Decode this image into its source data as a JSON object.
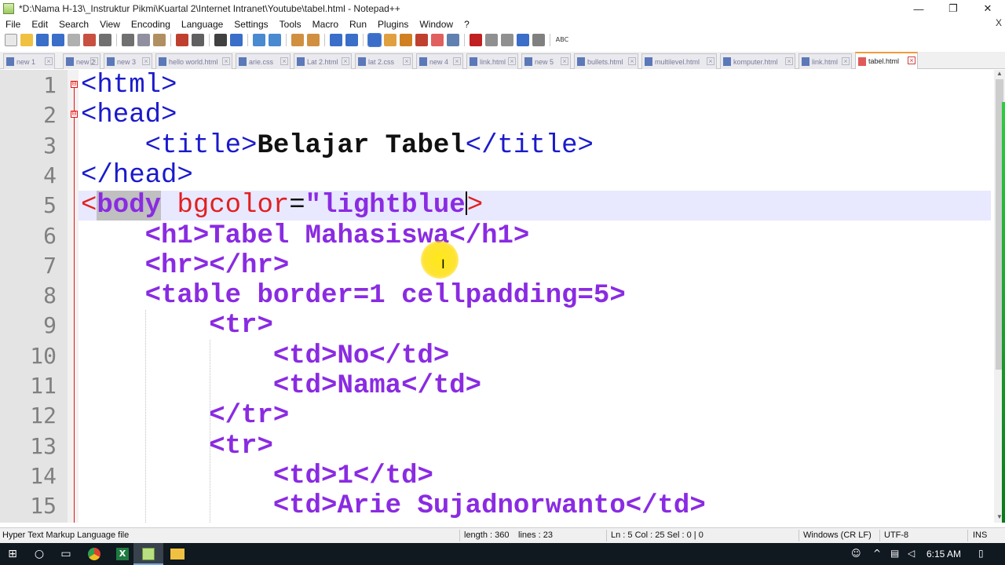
{
  "window": {
    "title": "*D:\\Nama H-13\\_Instruktur Pikmi\\Kuartal 2\\Internet Intranet\\Youtube\\tabel.html - Notepad++",
    "minimize": "—",
    "restore": "❐",
    "close": "✕",
    "menu_close": "X"
  },
  "menu": [
    "File",
    "Edit",
    "Search",
    "View",
    "Encoding",
    "Language",
    "Settings",
    "Tools",
    "Macro",
    "Run",
    "Plugins",
    "Window",
    "?"
  ],
  "toolbar": {
    "spell_label": "ABC",
    "colors": {
      "new": "#e8e8e8",
      "open": "#f0c040",
      "save": "#3a6ec8",
      "cut": "#707070",
      "undo": "#c04030",
      "find": "#7050a0",
      "macro": "#c02020",
      "run": "#4a8a3a"
    }
  },
  "tabs": [
    {
      "label": "new 1"
    },
    {
      "label": "new 2"
    },
    {
      "label": "new 3"
    },
    {
      "label": "hello world.html"
    },
    {
      "label": "arie.css"
    },
    {
      "label": "Lat 2.html"
    },
    {
      "label": "lat 2.css"
    },
    {
      "label": "new 4"
    },
    {
      "label": "link.html"
    },
    {
      "label": "new 5"
    },
    {
      "label": "bullets.html"
    },
    {
      "label": "multilevel.html"
    },
    {
      "label": "komputer.html"
    },
    {
      "label": "link.html"
    },
    {
      "label": "tabel.html",
      "active": true
    }
  ],
  "tab_close_glyph": "⊠",
  "editor": {
    "lines": [
      {
        "n": "1",
        "tokens": [
          {
            "c": "t",
            "v": "<html>"
          }
        ]
      },
      {
        "n": "2",
        "tokens": [
          {
            "c": "t",
            "v": "<head>"
          }
        ]
      },
      {
        "n": "3",
        "tokens": [
          {
            "c": "sp",
            "v": "    "
          },
          {
            "c": "t",
            "v": "<title>"
          },
          {
            "c": "txt",
            "v": "Belajar Tabel"
          },
          {
            "c": "t",
            "v": "</title>"
          }
        ]
      },
      {
        "n": "4",
        "tokens": [
          {
            "c": "t",
            "v": "</head>"
          }
        ]
      },
      {
        "n": "5",
        "tokens": [
          {
            "c": "brk",
            "v": "<"
          },
          {
            "c": "tag-sel",
            "v": "body"
          },
          {
            "c": "sp",
            "v": " "
          },
          {
            "c": "attr",
            "v": "bgcolor"
          },
          {
            "c": "eq",
            "v": "="
          },
          {
            "c": "val",
            "v": "\"lightblue"
          },
          {
            "c": "caret",
            "v": ""
          },
          {
            "c": "brk",
            "v": ">"
          }
        ]
      },
      {
        "n": "6",
        "tokens": [
          {
            "c": "sp",
            "v": "    "
          },
          {
            "c": "tb2",
            "v": "<h1>"
          },
          {
            "c": "tb2",
            "v": "Tabel Mahasiswa"
          },
          {
            "c": "tb2",
            "v": "</h1>"
          }
        ]
      },
      {
        "n": "7",
        "tokens": [
          {
            "c": "sp",
            "v": "    "
          },
          {
            "c": "tb2",
            "v": "<hr></hr>"
          }
        ]
      },
      {
        "n": "8",
        "tokens": [
          {
            "c": "sp",
            "v": "    "
          },
          {
            "c": "tb2",
            "v": "<table border=1 cellpadding=5>"
          }
        ]
      },
      {
        "n": "9",
        "tokens": [
          {
            "c": "sp",
            "v": "        "
          },
          {
            "c": "tb2",
            "v": "<tr>"
          }
        ]
      },
      {
        "n": "10",
        "tokens": [
          {
            "c": "sp",
            "v": "            "
          },
          {
            "c": "tb2",
            "v": "<td>No</td>"
          }
        ]
      },
      {
        "n": "11",
        "tokens": [
          {
            "c": "sp",
            "v": "            "
          },
          {
            "c": "tb2",
            "v": "<td>Nama</td>"
          }
        ]
      },
      {
        "n": "12",
        "tokens": [
          {
            "c": "sp",
            "v": "        "
          },
          {
            "c": "tb2",
            "v": "</tr>"
          }
        ]
      },
      {
        "n": "13",
        "tokens": [
          {
            "c": "sp",
            "v": "        "
          },
          {
            "c": "tb2",
            "v": "<tr>"
          }
        ]
      },
      {
        "n": "14",
        "tokens": [
          {
            "c": "sp",
            "v": "            "
          },
          {
            "c": "tb2",
            "v": "<td>1</td>"
          }
        ]
      },
      {
        "n": "15",
        "tokens": [
          {
            "c": "sp",
            "v": "            "
          },
          {
            "c": "tb2",
            "v": "<td>Arie Sujadnorwanto</td>"
          }
        ]
      }
    ],
    "current_line": "5",
    "fold_glyph": "⊟"
  },
  "statusbar": {
    "file_type": "Hyper Text Markup Language file",
    "length": "length : 360",
    "lines": "lines : 23",
    "position": "Ln : 5    Col : 25    Sel : 0 | 0",
    "eol": "Windows (CR LF)",
    "encoding": "UTF-8",
    "mode": "INS"
  },
  "taskbar": {
    "time": "6:15 AM",
    "start_icon": "⊞",
    "search_icon": "○"
  }
}
